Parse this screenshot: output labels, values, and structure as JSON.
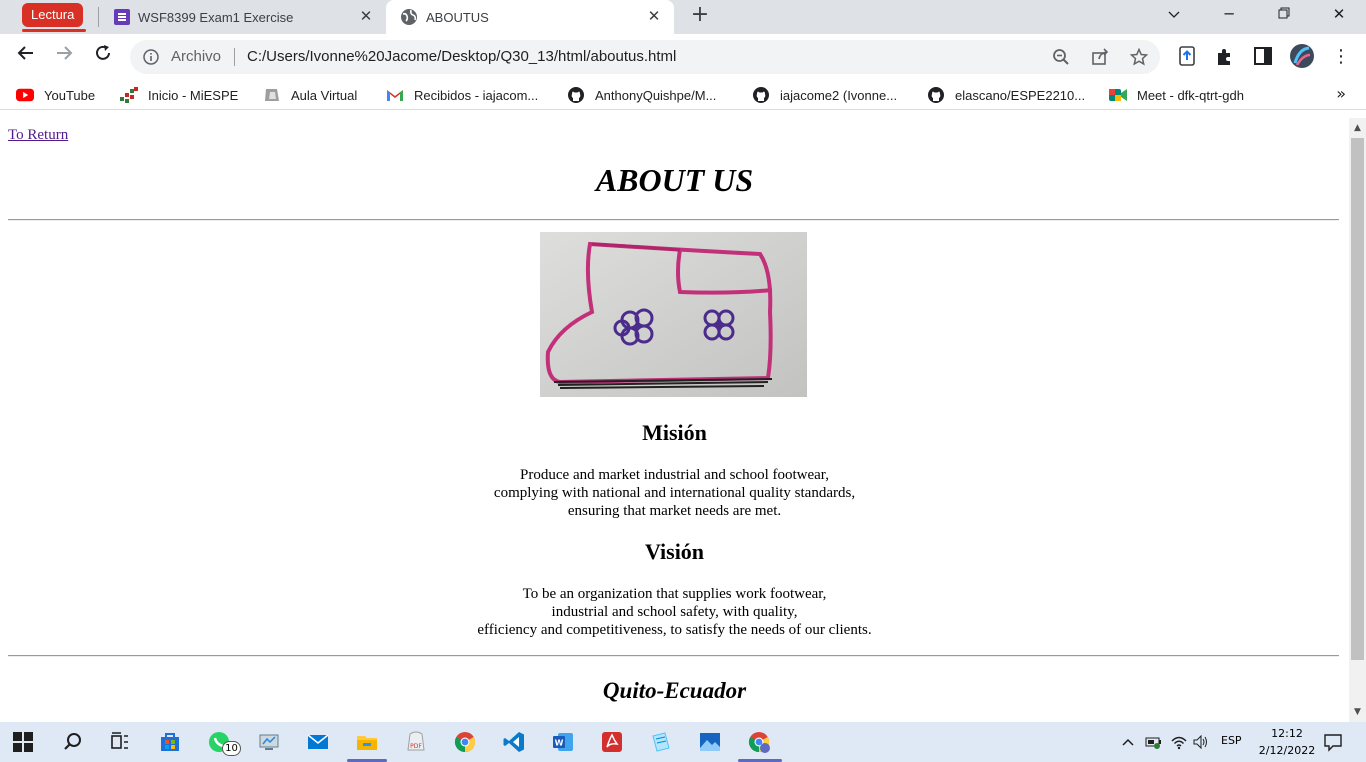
{
  "browser": {
    "tab_group_label": "Lectura",
    "tabs": [
      {
        "title": "WSF8399 Exam1 Exercise",
        "icon": "google-forms-icon",
        "active": false
      },
      {
        "title": "ABOUTUS",
        "icon": "globe-icon",
        "active": true
      }
    ],
    "omnibox": {
      "scheme_label": "Archivo",
      "url": "C:/Users/Ivonne%20Jacome/Desktop/Q30_13/html/aboutus.html"
    },
    "bookmarks": [
      {
        "label": "YouTube",
        "icon": "youtube-icon"
      },
      {
        "label": "Inicio - MiESPE",
        "icon": "miespe-icon"
      },
      {
        "label": "Aula Virtual",
        "icon": "aula-virtual-icon"
      },
      {
        "label": "Recibidos - iajacom...",
        "icon": "gmail-icon"
      },
      {
        "label": "AnthonyQuishpe/M...",
        "icon": "github-icon"
      },
      {
        "label": "iajacome2 (Ivonne...",
        "icon": "github-icon"
      },
      {
        "label": "elascano/ESPE2210...",
        "icon": "github-icon"
      },
      {
        "label": "Meet - dfk-qtrt-gdh",
        "icon": "google-meet-icon"
      }
    ],
    "bookmarks_overflow": "»"
  },
  "page": {
    "return_link": "To Return",
    "title": "ABOUT US",
    "mission_heading": "Misión",
    "mission_lines": [
      "Produce and market industrial and school footwear,",
      "complying with national and international quality standards,",
      "ensuring that market needs are met."
    ],
    "vision_heading": "Visión",
    "vision_lines": [
      "To be an organization that supplies work footwear,",
      "industrial and school safety, with quality,",
      "efficiency and competitiveness, to satisfy the needs of our clients."
    ],
    "footer": "Quito-Ecuador"
  },
  "taskbar": {
    "whatsapp_badge": "10",
    "language": "ESP",
    "time": "12:12",
    "date": "2/12/2022"
  },
  "colors": {
    "tab_group": "#d93025",
    "taskbar": "#dfe9f5",
    "link_visited": "#551a8b"
  }
}
